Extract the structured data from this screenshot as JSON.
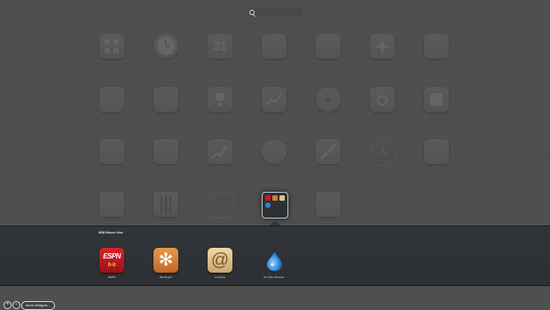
{
  "folder": {
    "title": "Will Never Use",
    "apps": [
      {
        "label": "ESPN",
        "icon": "espn-icon",
        "logo_text": "ESPN",
        "score_text": "0-0"
      },
      {
        "label": "Ski Report",
        "icon": "snowflake-icon"
      },
      {
        "label": "Contacts",
        "icon": "at-sign-icon",
        "glyph": "@"
      },
      {
        "label": "EY Filter Browser",
        "icon": "water-drop-icon"
      }
    ]
  },
  "background_widgets": {
    "row1": [
      {
        "icon": "grid-icon",
        "label": ""
      },
      {
        "icon": "clock-icon",
        "label": ""
      },
      {
        "icon": "calendar-icon",
        "label": "",
        "text": "31"
      },
      {
        "icon": "notes-icon",
        "label": ""
      },
      {
        "icon": "stickies-icon",
        "label": ""
      },
      {
        "icon": "airplane-icon",
        "label": ""
      },
      {
        "icon": "ticket-icon",
        "label": ""
      }
    ],
    "row2": [
      {
        "icon": "calculator-icon",
        "label": ""
      },
      {
        "icon": "translation-icon",
        "label": ""
      },
      {
        "icon": "trophy-icon",
        "label": ""
      },
      {
        "icon": "chart-icon",
        "label": ""
      },
      {
        "icon": "cd-icon",
        "label": ""
      },
      {
        "icon": "camera-icon",
        "label": ""
      },
      {
        "icon": "unit-converter-icon",
        "label": ""
      }
    ],
    "row3": [
      {
        "icon": "address-book-icon",
        "label": ""
      },
      {
        "icon": "web-clip-icon",
        "label": ""
      },
      {
        "icon": "stocks-icon",
        "label": ""
      },
      {
        "icon": "tile-game-icon",
        "label": ""
      },
      {
        "icon": "weather-icon",
        "label": ""
      },
      {
        "icon": "world-clock-icon",
        "label": ""
      },
      {
        "icon": "dictionary-icon",
        "label": ""
      }
    ],
    "row4": [
      {
        "icon": "mail-icon",
        "label": ""
      },
      {
        "icon": "piano-icon",
        "label": ""
      },
      {
        "icon": "blank-widget-icon",
        "label": ""
      },
      {
        "icon": "folder-icon",
        "label": ""
      },
      {
        "icon": "movies-icon",
        "label": ""
      }
    ]
  },
  "dashbar": {
    "add_glyph": "+",
    "remove_glyph": "−",
    "more_widgets": "More Widgets..."
  },
  "colors": {
    "espn_red": "#c8182a",
    "ski_orange": "#d57a38",
    "contacts_tan": "#e0c48b",
    "browser_blue": "#2a86d6"
  }
}
